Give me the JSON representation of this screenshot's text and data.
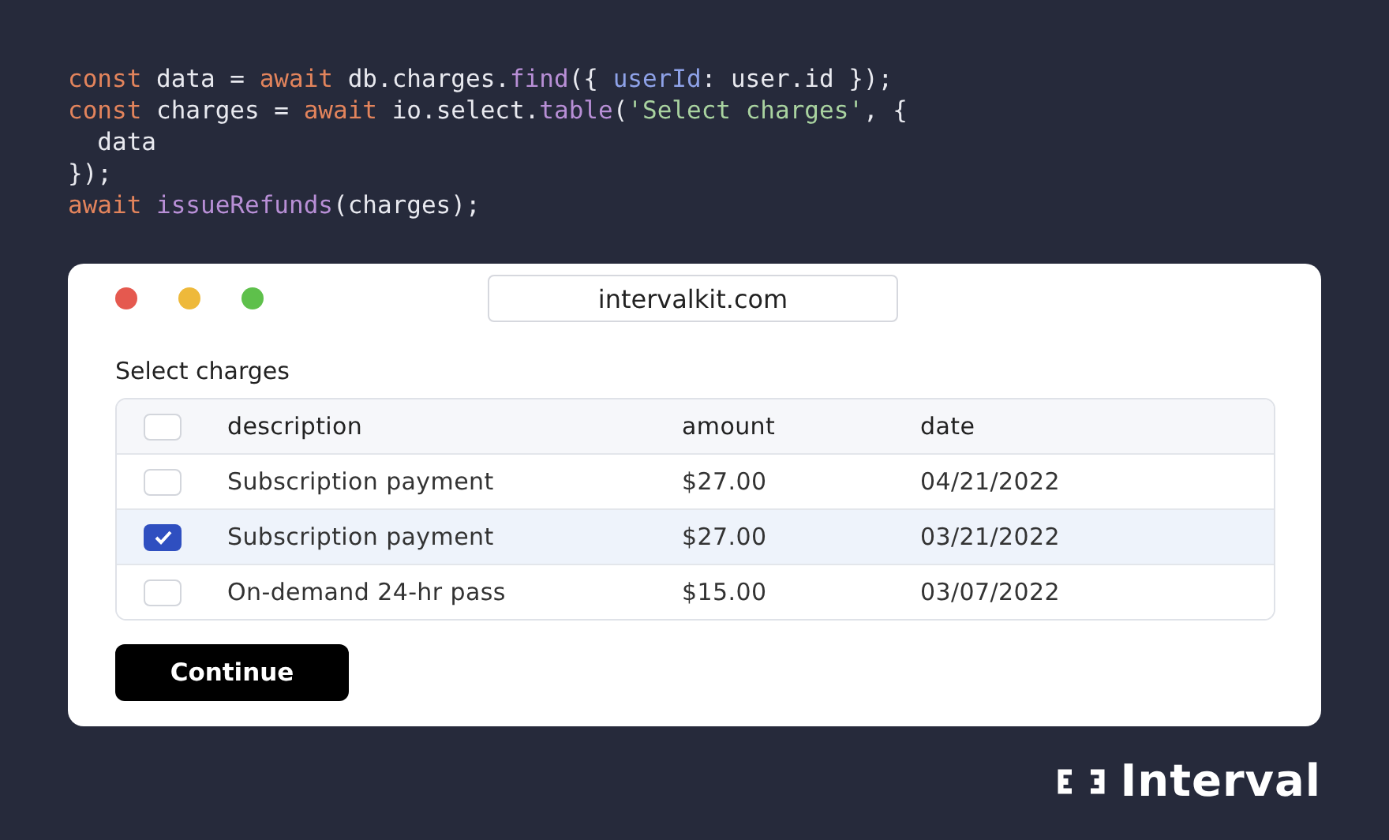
{
  "code": [
    [
      {
        "kind": "keyword",
        "text": "const"
      },
      {
        "kind": "plain",
        "text": " data = "
      },
      {
        "kind": "keyword",
        "text": "await"
      },
      {
        "kind": "plain",
        "text": " db.charges."
      },
      {
        "kind": "function",
        "text": "find"
      },
      {
        "kind": "plain",
        "text": "({ "
      },
      {
        "kind": "property",
        "text": "userId"
      },
      {
        "kind": "plain",
        "text": ": user.id });"
      }
    ],
    [
      {
        "kind": "keyword",
        "text": "const"
      },
      {
        "kind": "plain",
        "text": " charges = "
      },
      {
        "kind": "keyword",
        "text": "await"
      },
      {
        "kind": "plain",
        "text": " io.select."
      },
      {
        "kind": "function",
        "text": "table"
      },
      {
        "kind": "plain",
        "text": "("
      },
      {
        "kind": "string",
        "text": "'Select charges'"
      },
      {
        "kind": "plain",
        "text": ", {"
      }
    ],
    [
      {
        "kind": "plain",
        "text": "  data"
      }
    ],
    [
      {
        "kind": "plain",
        "text": "});"
      }
    ],
    [
      {
        "kind": "keyword",
        "text": "await "
      },
      {
        "kind": "function",
        "text": "issueRefunds"
      },
      {
        "kind": "plain",
        "text": "(charges);"
      }
    ]
  ],
  "browser": {
    "url": "intervalkit.com"
  },
  "form": {
    "title": "Select charges",
    "table": {
      "header_checked": false,
      "columns": [
        "description",
        "amount",
        "date"
      ],
      "rows": [
        {
          "selected": false,
          "cells": [
            "Subscription payment",
            "$27.00",
            "04/21/2022"
          ]
        },
        {
          "selected": true,
          "cells": [
            "Subscription payment",
            "$27.00",
            "03/21/2022"
          ]
        },
        {
          "selected": false,
          "cells": [
            "On-demand 24-hr pass",
            "$15.00",
            "03/07/2022"
          ]
        }
      ]
    },
    "button": "Continue"
  },
  "logo": {
    "text": "Interval"
  }
}
